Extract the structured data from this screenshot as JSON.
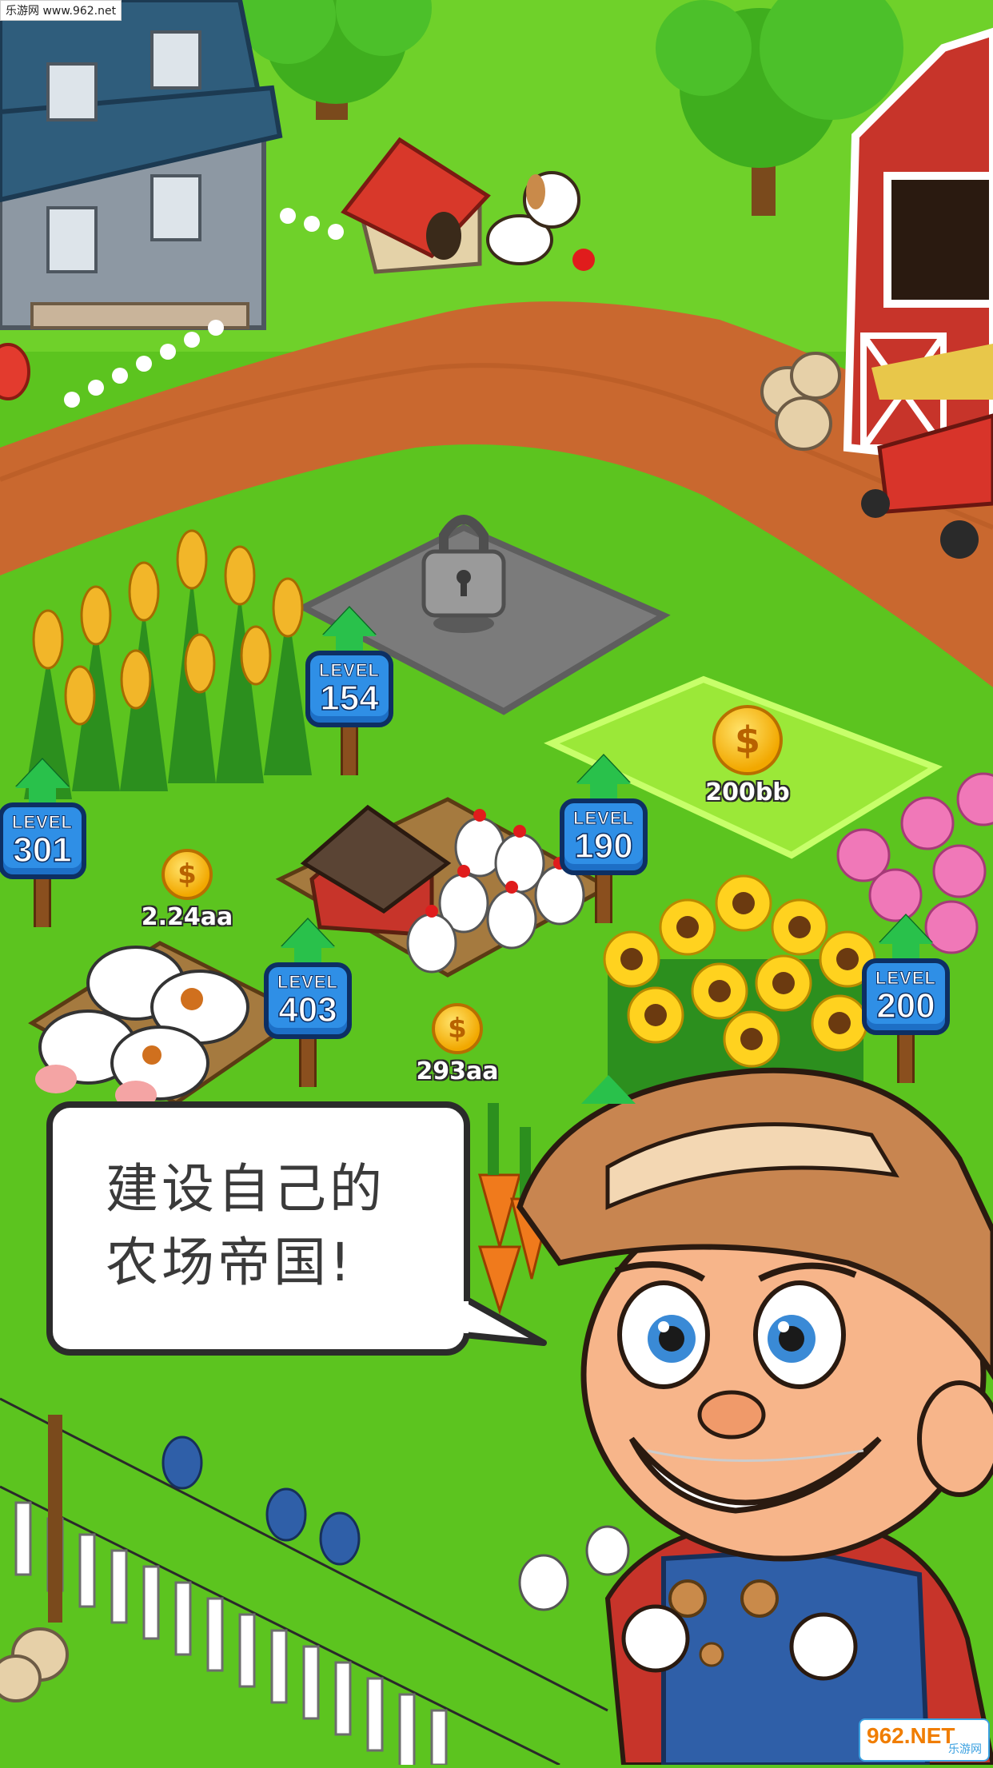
{
  "watermark_top": "乐游网 www.962.net",
  "speech_bubble": {
    "line1": "建设自己的",
    "line2": "农场帝国!"
  },
  "level_signs": [
    {
      "label": "LEVEL",
      "value": "154"
    },
    {
      "label": "LEVEL",
      "value": "301"
    },
    {
      "label": "LEVEL",
      "value": "190"
    },
    {
      "label": "LEVEL",
      "value": "403"
    },
    {
      "label": "LEVEL",
      "value": "200"
    }
  ],
  "coins": [
    {
      "symbol": "$",
      "value": "2.24aa"
    },
    {
      "symbol": "$",
      "value": "293aa"
    },
    {
      "symbol": "$",
      "value": "200bb"
    }
  ],
  "watermark_bottom": {
    "logo": "962.NET",
    "sub": "乐游网"
  },
  "colors": {
    "grass": "#5cc41f",
    "dirt_path": "#c9682f",
    "level_board": "#2f8fe6",
    "level_arrow": "#29c14b",
    "coin": "#f2a800"
  }
}
